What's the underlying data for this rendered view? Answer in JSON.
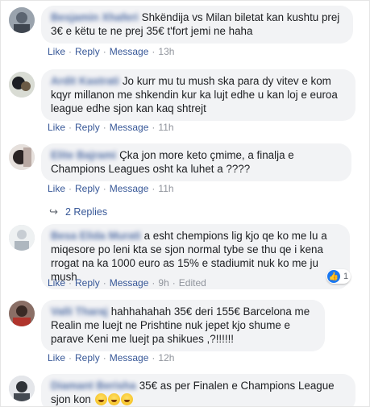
{
  "actions": {
    "like": "Like",
    "reply": "Reply",
    "message": "Message",
    "separator": "·",
    "edited": "Edited"
  },
  "comments": [
    {
      "name": "Besjamin Xhaferi",
      "text": "Shkëndija vs Milan biletat kan kushtu prej 3€ e këtu te ne prej 35€ t'fort jemi ne haha",
      "time": "13h"
    },
    {
      "name": "Ardit Kastrati",
      "text": "Jo kurr mu tu mush ska para dy vitev e kom kqyr millanon me shkendin kur ka lujt edhe u kan loj e euroa league edhe sjon kan kaq shtrejt",
      "time": "11h"
    },
    {
      "name": "Elite Bajrami",
      "text": "Çka jon more keto çmime, a finalja e Champions Leagues osht ka luhet a ????",
      "time": "11h"
    },
    {
      "name": "Besa Elida Murati",
      "text": "a esht chempions lig kjo qe ko me lu a miqesore po leni kta se sjon normal tybe se thu qe i kena rrogat na ka 1000 euro as 15% e stadiumit nuk ko me ju mush",
      "time": "9h",
      "edited": true,
      "reaction_count": "1"
    },
    {
      "name": "Valli Tharaj",
      "text": "hahhahahah 35€ deri 155€ Barcelona me Realin me luejt ne Prishtine nuk jepet kjo shume e parave Keni me luejt pa shikues ,?!!!!!!",
      "time": "12h"
    },
    {
      "name": "Diamant Berisha",
      "text": "35€ as per Finalen e Champions League sjon kon",
      "time": ""
    }
  ],
  "replies": {
    "label": "2 Replies"
  }
}
